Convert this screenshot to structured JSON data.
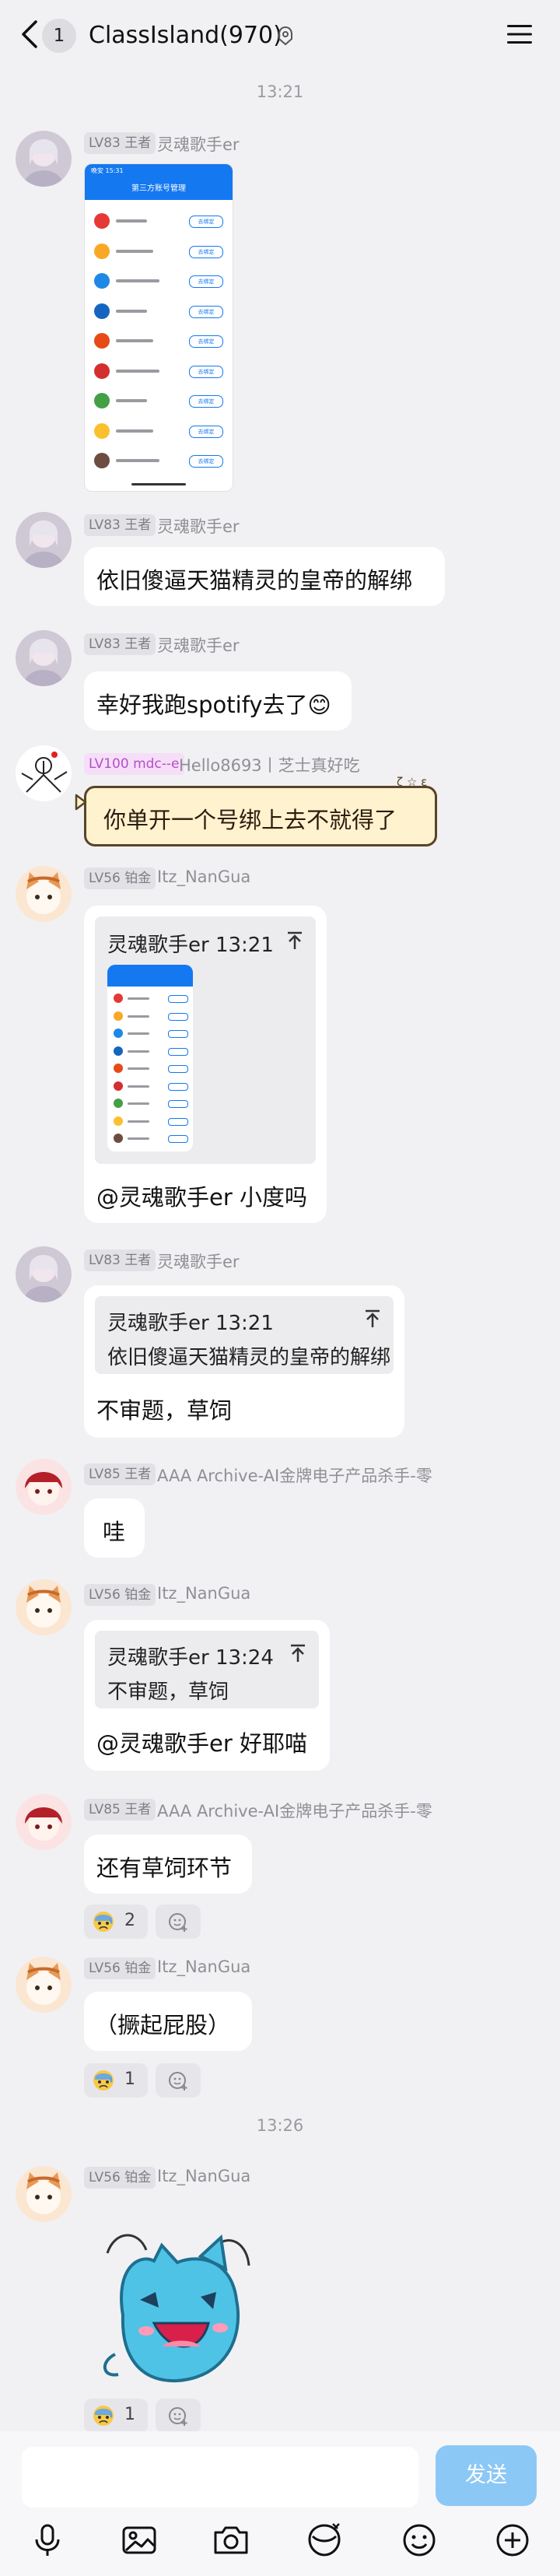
{
  "header": {
    "unread": "1",
    "title": "ClassIsland(970)"
  },
  "messages": {
    "t1": "13:21",
    "t2": "13:26",
    "m1": {
      "level": "LV83 王者",
      "nick": "灵魂歌手er",
      "screenshot": {
        "title": "第三方账号管理",
        "status_time": "晚安 15:31",
        "item_action": "去绑定"
      }
    },
    "m2": {
      "level": "LV83 王者",
      "nick": "灵魂歌手er",
      "text": "依旧傻逼天猫精灵的皇帝的解绑"
    },
    "m3": {
      "level": "LV83 王者",
      "nick": "灵魂歌手er",
      "text": "幸好我跑spotify去了😊"
    },
    "m4": {
      "level": "LV100 mdc--e",
      "nick": "Hello8693丨芝士真好吃",
      "text": "你单开一个号绑上去不就得了",
      "sticker": "ζ ☆ ε"
    },
    "m5": {
      "level": "LV56 铂金",
      "nick": "Itz_NanGua",
      "quote_name": "灵魂歌手er 13:21",
      "text": "@灵魂歌手er 小度吗"
    },
    "m6": {
      "level": "LV83 王者",
      "nick": "灵魂歌手er",
      "quote_name": "灵魂歌手er 13:21",
      "quote_text": "依旧傻逼天猫精灵的皇帝的解绑",
      "text": "不审题，草饲"
    },
    "m7": {
      "level": "LV85 王者",
      "nick": "AAA Archive-AI金牌电子产品杀手-零",
      "text": "哇"
    },
    "m8": {
      "level": "LV56 铂金",
      "nick": "Itz_NanGua",
      "quote_name": "灵魂歌手er 13:24",
      "quote_text": "不审题，草饲",
      "text": "@灵魂歌手er 好耶喵"
    },
    "m9": {
      "level": "LV85 王者",
      "nick": "AAA Archive-AI金牌电子产品杀手-零",
      "text": "还有草饲环节",
      "reaction_count": "2"
    },
    "m10": {
      "level": "LV56 铂金",
      "nick": "Itz_NanGua",
      "text": "（撅起屁股）",
      "reaction_count": "1"
    },
    "m11": {
      "level": "LV56 铂金",
      "nick": "Itz_NanGua",
      "reaction_count": "1"
    }
  },
  "input": {
    "send_label": "发送"
  },
  "colors": {
    "background": "#f1f1f4",
    "bubble": "#ffffff",
    "send": "#8cc8f6",
    "accent": "#1478f0"
  }
}
